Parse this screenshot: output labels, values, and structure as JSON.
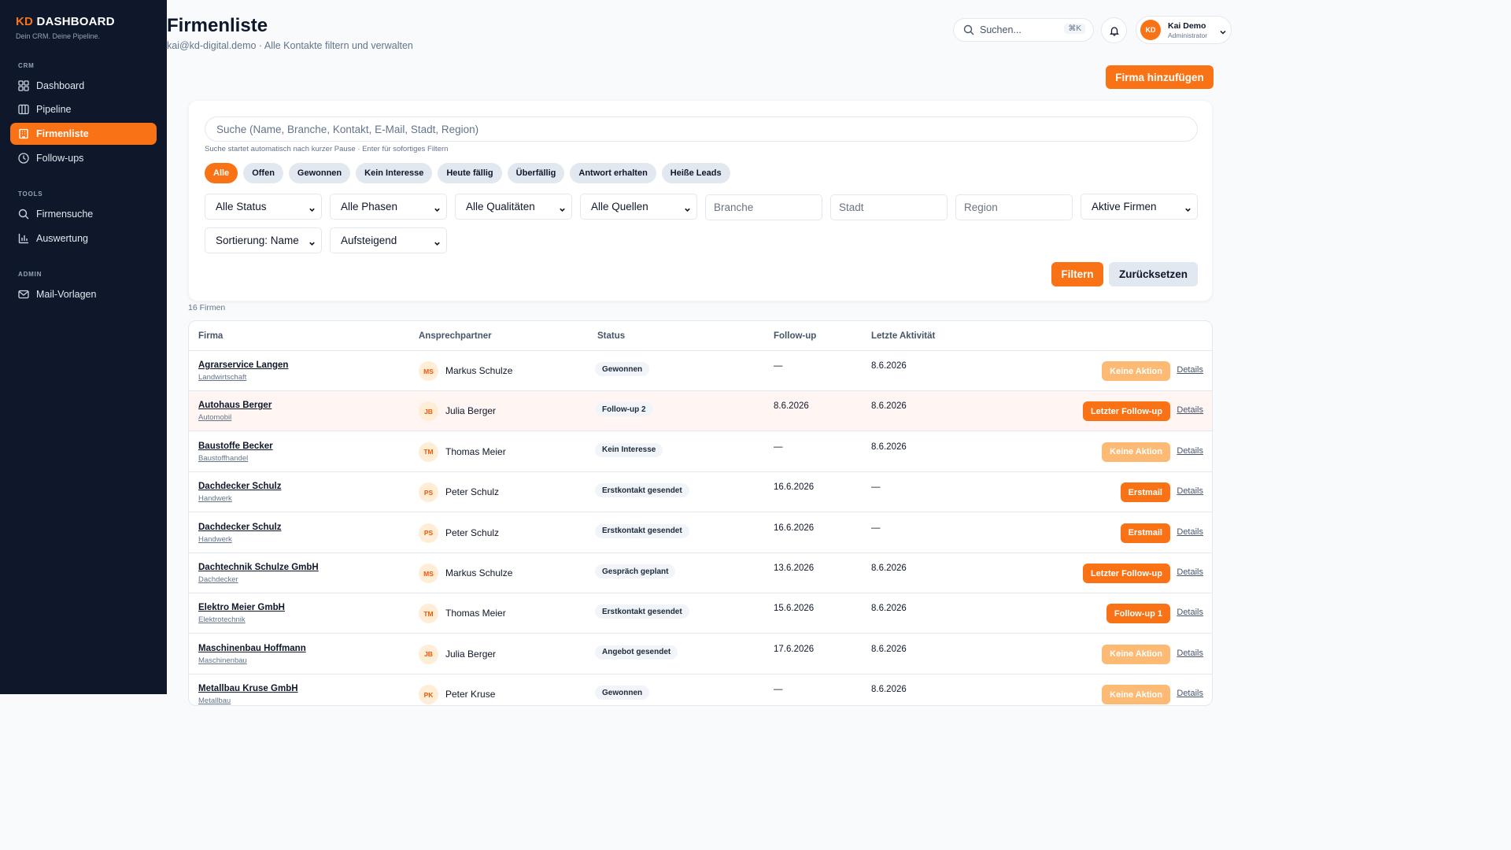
{
  "sidebar": {
    "brand_kd": "KD",
    "brand_rest": " DASHBOARD",
    "tagline": "Dein CRM. Deine Pipeline.",
    "sections": {
      "crm": "CRM",
      "tools": "TOOLS",
      "admin": "ADMIN"
    },
    "items": [
      {
        "label": "Dashboard",
        "icon": "grid-icon"
      },
      {
        "label": "Pipeline",
        "icon": "columns-icon"
      },
      {
        "label": "Firmenliste",
        "icon": "building-icon",
        "active": true
      },
      {
        "label": "Follow-ups",
        "icon": "clock-icon"
      },
      {
        "label": "Firmensuche",
        "icon": "search-icon"
      },
      {
        "label": "Auswertung",
        "icon": "bar-chart-icon"
      },
      {
        "label": "Mail-Vorlagen",
        "icon": "mail-icon"
      }
    ]
  },
  "header": {
    "title": "Firmenliste",
    "subtitle": "kai@kd-digital.demo · Alle Kontakte filtern und verwalten",
    "search_placeholder": "Suchen...",
    "search_shortcut": "⌘K",
    "user": {
      "initials": "KD",
      "name": "Kai Demo",
      "role": "Administrator"
    },
    "add_button": "Firma hinzufügen"
  },
  "filters": {
    "search_placeholder": "Suche (Name, Branche, Kontakt, E-Mail, Stadt, Region)",
    "hint": "Suche startet automatisch nach kurzer Pause · Enter für sofortiges Filtern",
    "chips": [
      "Alle",
      "Offen",
      "Gewonnen",
      "Kein Interesse",
      "Heute fällig",
      "Überfällig",
      "Antwort erhalten",
      "Heiße Leads"
    ],
    "active_chip": "Alle",
    "status": "Alle Status",
    "phase": "Alle Phasen",
    "quality": "Alle Qualitäten",
    "source": "Alle Quellen",
    "branche_placeholder": "Branche",
    "stadt_placeholder": "Stadt",
    "region_placeholder": "Region",
    "active_scope": "Aktive Firmen",
    "sort": "Sortierung: Name",
    "order": "Aufsteigend",
    "filter_button": "Filtern",
    "reset_button": "Zurücksetzen"
  },
  "count_label": "16 Firmen",
  "table": {
    "columns": [
      "Firma",
      "Ansprechpartner",
      "Status",
      "Follow-up",
      "Letzte Aktivität"
    ],
    "details_label": "Details",
    "rows": [
      {
        "name": "Agrarservice Langen",
        "industry": "Landwirtschaft",
        "initials": "MS",
        "contact": "Markus Schulze",
        "status": "Gewonnen",
        "followup": "—",
        "activity": "8.6.2026",
        "action": "Keine Aktion",
        "muted": true,
        "highlight": false
      },
      {
        "name": "Autohaus Berger",
        "industry": "Automobil",
        "initials": "JB",
        "contact": "Julia Berger",
        "status": "Follow-up 2",
        "followup": "8.6.2026",
        "activity": "8.6.2026",
        "action": "Letzter Follow-up",
        "muted": false,
        "highlight": true
      },
      {
        "name": "Baustoffe Becker",
        "industry": "Baustoffhandel",
        "initials": "TM",
        "contact": "Thomas Meier",
        "status": "Kein Interesse",
        "followup": "—",
        "activity": "8.6.2026",
        "action": "Keine Aktion",
        "muted": true,
        "highlight": false
      },
      {
        "name": "Dachdecker Schulz",
        "industry": "Handwerk",
        "initials": "PS",
        "contact": "Peter Schulz",
        "status": "Erstkontakt gesendet",
        "followup": "16.6.2026",
        "activity": "—",
        "action": "Erstmail",
        "muted": false,
        "highlight": false
      },
      {
        "name": "Dachdecker Schulz",
        "industry": "Handwerk",
        "initials": "PS",
        "contact": "Peter Schulz",
        "status": "Erstkontakt gesendet",
        "followup": "16.6.2026",
        "activity": "—",
        "action": "Erstmail",
        "muted": false,
        "highlight": false
      },
      {
        "name": "Dachtechnik Schulze GmbH",
        "industry": "Dachdecker",
        "initials": "MS",
        "contact": "Markus Schulze",
        "status": "Gespräch geplant",
        "followup": "13.6.2026",
        "activity": "8.6.2026",
        "action": "Letzter Follow-up",
        "muted": false,
        "highlight": false
      },
      {
        "name": "Elektro Meier GmbH",
        "industry": "Elektrotechnik",
        "initials": "TM",
        "contact": "Thomas Meier",
        "status": "Erstkontakt gesendet",
        "followup": "15.6.2026",
        "activity": "8.6.2026",
        "action": "Follow-up 1",
        "muted": false,
        "highlight": false
      },
      {
        "name": "Maschinenbau Hoffmann",
        "industry": "Maschinenbau",
        "initials": "JB",
        "contact": "Julia Berger",
        "status": "Angebot gesendet",
        "followup": "17.6.2026",
        "activity": "8.6.2026",
        "action": "Keine Aktion",
        "muted": true,
        "highlight": false
      },
      {
        "name": "Metallbau Kruse GmbH",
        "industry": "Metallbau",
        "initials": "PK",
        "contact": "Peter Kruse",
        "status": "Gewonnen",
        "followup": "—",
        "activity": "8.6.2026",
        "action": "Keine Aktion",
        "muted": true,
        "highlight": false
      }
    ]
  },
  "colors": {
    "accent": "#f97316",
    "sidebar_bg": "#0f172a",
    "muted_action": "#fdba74",
    "highlight_row": "#fff5f3"
  }
}
